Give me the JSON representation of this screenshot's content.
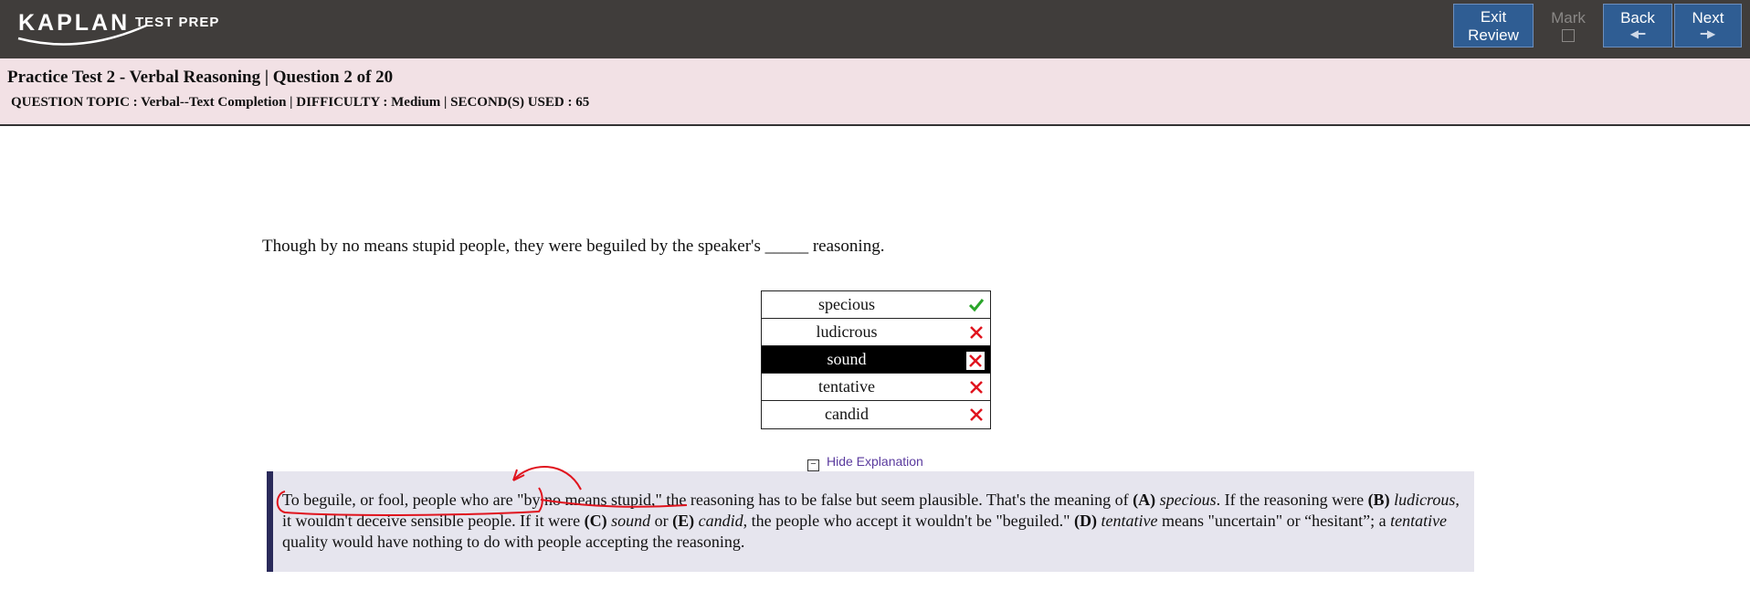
{
  "logo": {
    "brand": "KAPLAN",
    "sub": "TEST PREP"
  },
  "nav": {
    "exit_line1": "Exit",
    "exit_line2": "Review",
    "mark_label": "Mark",
    "back_label": "Back",
    "next_label": "Next"
  },
  "header": {
    "title": "Practice Test 2 - Verbal Reasoning | Question 2 of 20",
    "meta": "QUESTION TOPIC : Verbal--Text Completion | DIFFICULTY : Medium | SECOND(S) USED : 65"
  },
  "question": {
    "stem": "Though by no means stupid people, they were beguiled by the speaker's _____ reasoning.",
    "choices": [
      {
        "label": "specious",
        "status": "correct"
      },
      {
        "label": "ludicrous",
        "status": "incorrect"
      },
      {
        "label": "sound",
        "status": "incorrect-selected"
      },
      {
        "label": "tentative",
        "status": "incorrect"
      },
      {
        "label": "candid",
        "status": "incorrect"
      }
    ]
  },
  "explanation": {
    "toggle_label": "Hide Explanation",
    "p1": "To beguile, or fool, people who are \"by no means stupid,\" the reasoning has to be false but seem plausible. That's the meaning of ",
    "a_letter": "(A)",
    "a_word": "specious",
    "p2": ". If the reasoning were ",
    "b_letter": "(B)",
    "b_word": "ludicrous",
    "p3": ", it wouldn't deceive sensible people. If it were ",
    "c_letter": "(C)",
    "c_word": "sound",
    "p4": " or ",
    "e_letter": "(E)",
    "e_word": "candid",
    "p5": ", the people who accept it wouldn't be \"beguiled.\" ",
    "d_letter": "(D)",
    "d_word": "tentative",
    "p6": " means \"uncertain\" or “hesitant”; a ",
    "d_word2": "tentative",
    "p7": " quality would have nothing to do with people accepting the reasoning."
  },
  "colors": {
    "topbar": "#403d3b",
    "nav_button": "#2f5d93",
    "header_bg": "#f2e1e5",
    "explanation_bg": "#e6e5ee",
    "correct": "#2aa52a",
    "incorrect": "#e0141e",
    "annotation": "#e0141e"
  }
}
